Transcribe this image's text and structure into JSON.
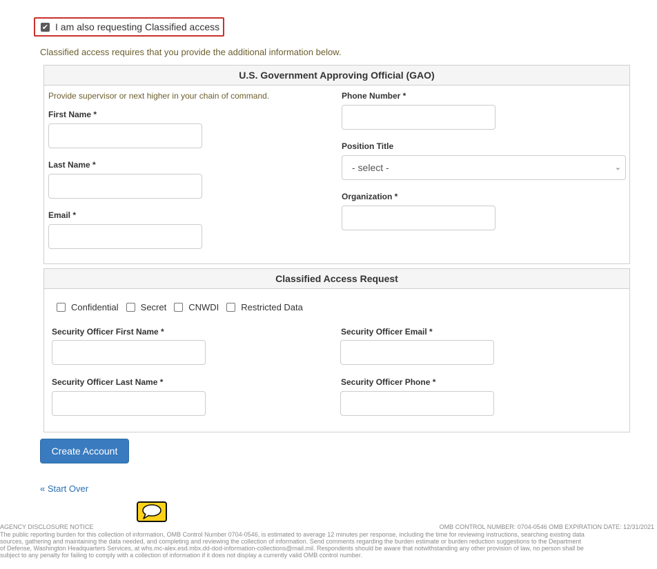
{
  "classified_checkbox": {
    "label": "I am also requesting Classified access",
    "checked": true,
    "check_glyph": "✔"
  },
  "intro_text": "Classified access requires that you provide the additional information below.",
  "gao": {
    "title": "U.S. Government Approving Official (GAO)",
    "hint": "Provide supervisor or next higher in your chain of command.",
    "first_name_label": "First Name *",
    "last_name_label": "Last Name *",
    "email_label": "Email *",
    "phone_label": "Phone Number *",
    "position_label": "Position Title",
    "position_value": "- select -",
    "organization_label": "Organization *"
  },
  "car": {
    "title": "Classified Access Request",
    "options": [
      "Confidential",
      "Secret",
      "CNWDI",
      "Restricted Data"
    ],
    "so_first_label": "Security Officer First Name *",
    "so_email_label": "Security Officer Email *",
    "so_last_label": "Security Officer Last Name *",
    "so_phone_label": "Security Officer Phone *"
  },
  "create_button": "Create Account",
  "start_over": "« Start Over",
  "footer": {
    "notice_title": "AGENCY DISCLOSURE NOTICE",
    "omb": "OMB CONTROL NUMBER: 0704-0546 OMB EXPIRATION DATE: 12/31/2021",
    "lines": [
      "The public reporting burden for this collection of information, OMB Control Number 0704-0546, is estimated to average 12 minutes per response, including the time for reviewing instructions, searching existing data",
      "sources, gathering and maintaining the data needed, and completing and reviewing the collection of information. Send comments regarding the burden estimate or burden reduction suggestions to the Department",
      "of Defense, Washington Headquarters Services, at whs.mc-alex.esd.mbx.dd-dod-information-collections@mail.mil. Respondents should be aware that notwithstanding any other provision of law, no person shall be",
      "subject to any penalty for failing to comply with a collection of information if it does not display a currently valid OMB control number."
    ]
  },
  "colors": {
    "accent": "#3a7bbf",
    "highlight_border": "#c9302c",
    "hint": "#6b5e2e",
    "link": "#2a6fb3"
  },
  "icons": {
    "comment": "speech-bubble-icon",
    "select_arrow": "chevron-down-icon"
  }
}
